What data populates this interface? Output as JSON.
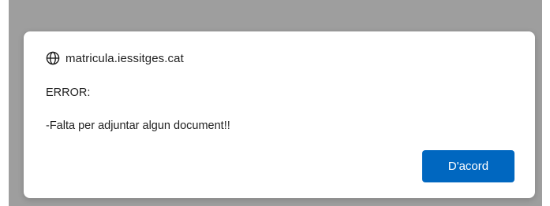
{
  "dialog": {
    "origin": "matricula.iessitges.cat",
    "origin_icon": "globe-icon",
    "message_title": "ERROR:",
    "message_body": "-Falta per adjuntar algun document!!",
    "ok_label": "D'acord"
  },
  "colors": {
    "backdrop": "#9e9e9e",
    "dialog_background": "#ffffff",
    "button_accent": "#0067c0",
    "text": "#1f1f1f"
  }
}
